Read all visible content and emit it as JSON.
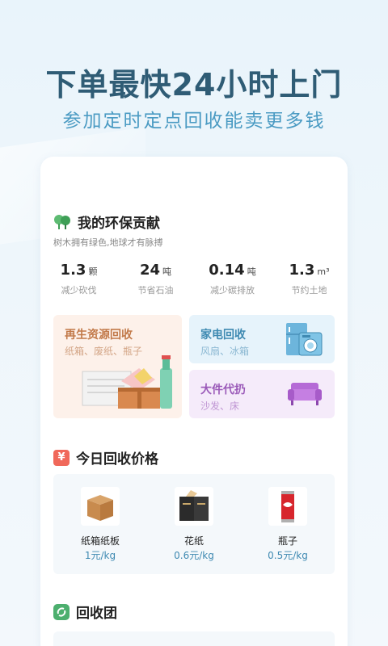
{
  "hero": {
    "title": "下单最快24小时上门",
    "subtitle": "参加定时定点回收能卖更多钱"
  },
  "eco": {
    "title": "我的环保贡献",
    "subtitle": "树木拥有绿色,地球才有脉搏",
    "icon": "tree-icon",
    "stats": [
      {
        "value": "1.3",
        "unit": "颗",
        "label": "减少砍伐"
      },
      {
        "value": "24",
        "unit": "吨",
        "label": "节省石油"
      },
      {
        "value": "0.14",
        "unit": "吨",
        "label": "减少碳排放"
      },
      {
        "value": "1.3",
        "unit": "m³",
        "label": "节约土地"
      }
    ]
  },
  "services": [
    {
      "title": "再生资源回收",
      "subtitle": "纸箱、废纸、瓶子"
    },
    {
      "title": "家电回收",
      "subtitle": "风扇、冰箱"
    },
    {
      "title": "大件代扔",
      "subtitle": "沙发、床"
    }
  ],
  "prices": {
    "title": "今日回收价格",
    "icon_text": "¥",
    "items": [
      {
        "name": "纸箱纸板",
        "price": "1元/kg"
      },
      {
        "name": "花纸",
        "price": "0.6元/kg"
      },
      {
        "name": "瓶子",
        "price": "0.5元/kg"
      }
    ]
  },
  "group": {
    "title": "回收团"
  },
  "colors": {
    "accent": "#3f8ab2",
    "green": "#4caf6e",
    "red": "#f0685a"
  }
}
